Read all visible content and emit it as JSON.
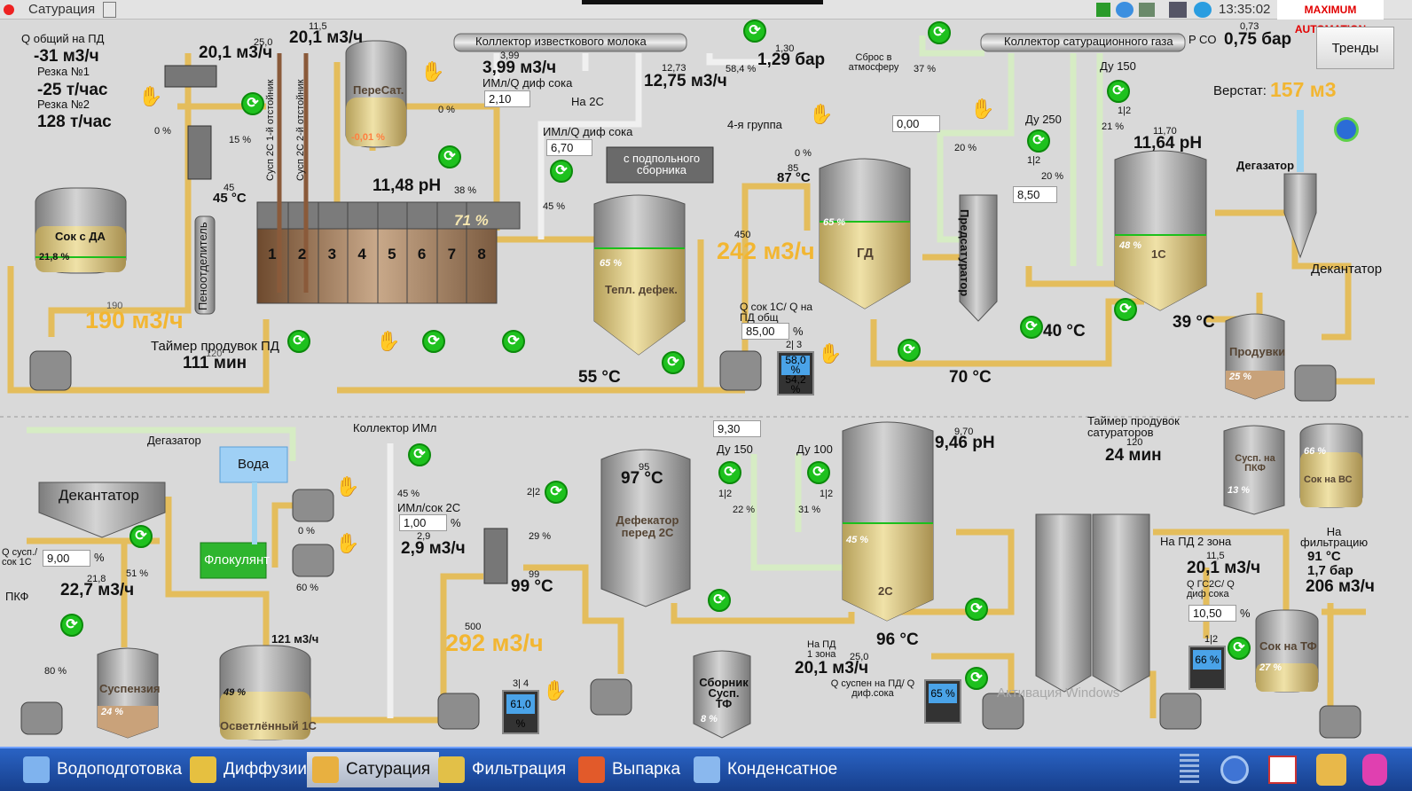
{
  "window": {
    "title": "Сатурация",
    "clock": "13:35:02",
    "logo": "MAXIMUM AUTOMATION",
    "trends_button": "Тренды"
  },
  "left_panel": {
    "q_total_label": "Q общий на ПД",
    "q_total_value": "-31 м3/ч",
    "cut1_label": "Резка №1",
    "cut1_value": "-25 т/час",
    "cut2_label": "Резка №2",
    "cut2_value": "128 т/час",
    "flow_top": "20,1 м3/ч",
    "flow_190": "190 м3/ч",
    "flow_190_sp": "190",
    "timer_label": "Таймер продувок ПД",
    "timer_value": "111 мин",
    "timer_sp": "120"
  },
  "collectors": {
    "lime_milk": "Коллектор известкового молока",
    "sat_gas": "Коллектор сатурационного газа",
    "iml": "Коллектор ИМл"
  },
  "top_values": {
    "v_25": "25,0",
    "v_11_5": "11,5",
    "flow_20_1b": "20,1 м3/ч",
    "flow_3_99_sp": "3,99",
    "flow_3_99": "3,99 м3/ч",
    "iml_ratio_label": "ИМл/Q диф сока",
    "iml_ratio_val": "2,10",
    "v_12_73": "12,73",
    "flow_12_75": "12,75 м3/ч",
    "p_1_30": "1,30",
    "p_1_29": "1,29 бар",
    "pct_58": "58,4 %",
    "to_2c": "На 2С",
    "iml_ratio2_label": "ИМл/Q диф сока",
    "iml_ratio2_val": "6,70",
    "from_sub": "с подпольного сборника",
    "release": "Сброс в атмосферу",
    "pct_37": "37 %",
    "pco2_label": "P CO",
    "pco2_sp": "0,73",
    "pco2_val": "0,75 бар",
    "du150": "Ду 150",
    "du250": "Ду 250",
    "verstat_label": "Верстат:",
    "verstat_val": "157 м3"
  },
  "tanks": {
    "juice_da": "Сок с ДА",
    "juice_da_pct": "21,8 %",
    "foam_sep": "Пеноотделитель",
    "peresat": "ПереСат.",
    "peresat_pct": "-0,01 %",
    "settler1": "Сусп 2С 1-й отстойник",
    "settler2": "Сусп 2С 2-й отстойник",
    "ph_1148": "11,48 pH",
    "sections": [
      "1",
      "2",
      "3",
      "4",
      "5",
      "6",
      "7",
      "8"
    ],
    "sections_pct": "71 %",
    "tepl": "Тепл. дефек.",
    "tepl_pct": "65 %",
    "gd": "ГД",
    "gd_pct": "65 %",
    "presat": "Предсатуратор",
    "s1c": "1С",
    "s1c_pct": "48 %",
    "ph_sp": "11,70",
    "ph": "11,64 pH",
    "degasator": "Дегазатор",
    "decanter": "Декантатор",
    "produvki": "Продувки",
    "produvki_pct": "25 %"
  },
  "mid_values": {
    "t45_sp": "45",
    "t45": "45 °C",
    "pct_15": "15 %",
    "pct_0a": "0 %",
    "pct_0b": "0 %",
    "pct_38": "38 %",
    "pct_45": "45 %",
    "group4": "4-я группа",
    "pct_0c": "0 %",
    "t85": "85",
    "t87": "87 °C",
    "f450": "450",
    "f242": "242 м3/ч",
    "q1c_label": "Q сок 1С/ Q на ПД общ",
    "q1c_val": "85,00",
    "pct_sym": "%",
    "ind23": "2| 3",
    "mon1": "58,0 % 54,2 %",
    "t55": "55 °C",
    "t70": "70 °C",
    "t40": "40 °C",
    "t39": "39 °C",
    "v000": "0,00",
    "pct_20a": "20 %",
    "pct_20b": "20 %",
    "pct_21": "21 %",
    "v850": "8,50",
    "half": "1|2"
  },
  "bottom": {
    "degas": "Дегазатор",
    "decanter": "Декантатор",
    "water": "Вода",
    "flocc": "Флокулянт",
    "q_susp_label": "Q сусп./ сок 1С",
    "q_susp_val": "9,00",
    "pct_51": "51 %",
    "sp218": "21,8",
    "f227": "22,7 м3/ч",
    "pkf": "ПКФ",
    "pct_80": "80 %",
    "susp": "Суспензия",
    "susp_pct": "24 %",
    "pct_0": "0 %",
    "pct_60": "60 %",
    "f121": "121 м3/ч",
    "clar": "Осветлённый 1С",
    "clar_pct": "49 %",
    "pct_45": "45 %",
    "iml2c_label": "ИМл/сок 2С",
    "iml2c_val": "1,00",
    "sp29": "2,9",
    "f29": "2,9 м3/ч",
    "f500": "500",
    "f292": "292 м3/ч",
    "ind34": "3| 4",
    "mon2": "61,0 %",
    "ind22": "2|2",
    "pct_29": "29 %",
    "t99sp": "99",
    "t99": "99 °C",
    "sbor": "Сборник Сусп. ТФ",
    "sbor_pct": "8 %",
    "t95": "95",
    "t97": "97 °C",
    "defek": "Дефекатор перед 2С",
    "v930": "9,30",
    "du150b": "Ду 150",
    "du100": "Ду 100",
    "pct_22": "22 %",
    "pct_31": "31 %",
    "s2c": "2С",
    "s2c_pct": "45 %",
    "ph_sp": "9,70",
    "ph": "9,46 pH",
    "t96": "96 °C",
    "na_pd1": "На ПД 1 зона",
    "sp25": "25,0",
    "f201": "20,1 м3/ч",
    "q_label": "Q суспен на ПД/ Q диф.сока",
    "mon3": "65 %",
    "timer_label": "Таймер продувок сатураторов",
    "timer_sp": "120",
    "timer_val": "24 мин",
    "pkf_susp": "Сусп. на ПКФ",
    "pkf_pct": "13 %",
    "vs_juice": "Сок на ВС",
    "vs_pct": "66 %",
    "na_pd2": "На ПД 2 зона",
    "sp115": "11,5",
    "f201b": "20,1 м3/ч",
    "qgs_label": "Q ГС2С/ Q диф сока",
    "qgs_val": "10,50",
    "ind12": "1|2",
    "mon4": "66 %",
    "tf_juice": "Сок на ТФ",
    "tf_pct": "27 %",
    "filt_label": "На фильтрацию",
    "t91": "91 °C",
    "p17": "1,7 бар",
    "f206": "206 м3/ч",
    "watermark": "Активация Windows"
  },
  "taskbar": [
    "Водоподготовка",
    "Диффузии",
    "Сатурация",
    "Фильтрация",
    "Выпарка",
    "Конденсатное"
  ],
  "colors": {
    "pipe": "#e8c36a",
    "pipe_light": "#d9f0c8",
    "green": "#22b722",
    "gold": "#f2b632",
    "tank": "#a8a8a8",
    "task": "#1f4fa8"
  }
}
